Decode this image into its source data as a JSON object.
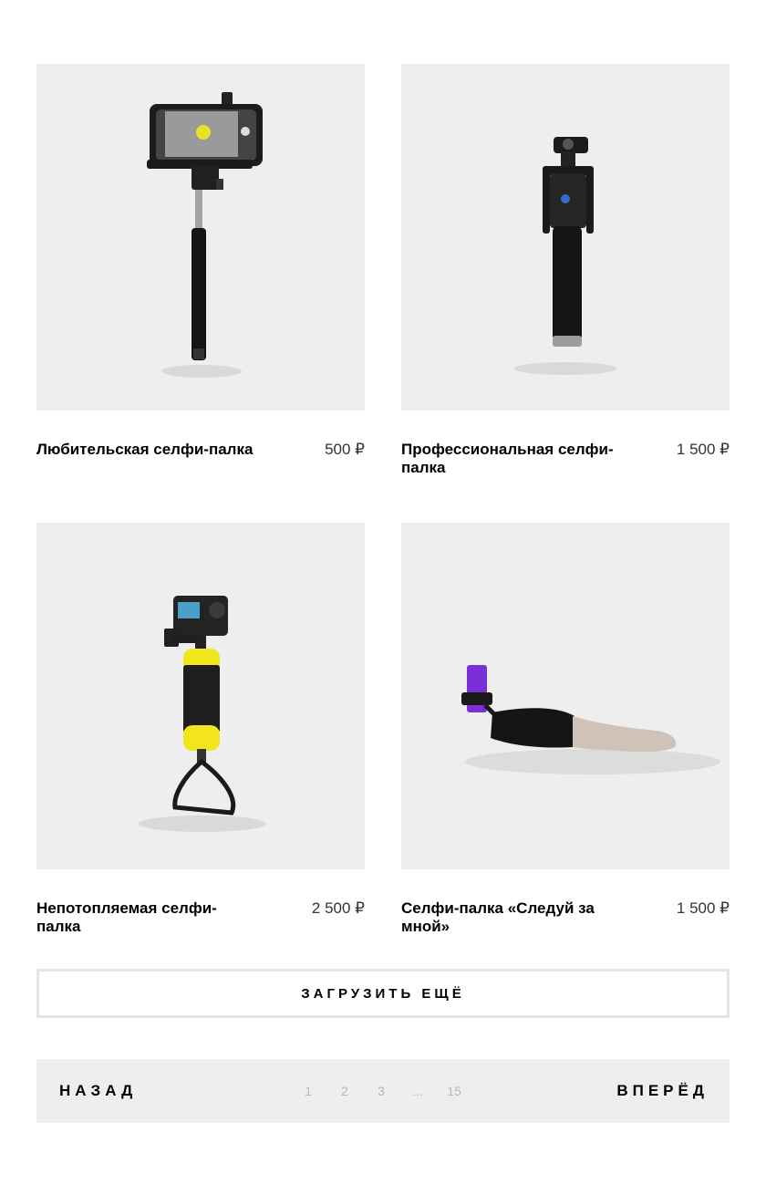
{
  "products": [
    {
      "title": "Любительская селфи-палка",
      "price": "500 ₽"
    },
    {
      "title": "Профессиональная селфи-палка",
      "price": "1 500 ₽"
    },
    {
      "title": "Непотопляемая селфи-палка",
      "price": "2 500 ₽"
    },
    {
      "title": "Селфи-палка «Следуй за мной»",
      "price": "1 500 ₽"
    }
  ],
  "load_more_label": "ЗАГРУЗИТЬ ЕЩЁ",
  "pagination": {
    "prev_label": "НАЗАД",
    "next_label": "ВПЕРЁД",
    "pages": [
      "1",
      "2",
      "3",
      "...",
      "15"
    ]
  },
  "colors": {
    "card_bg": "#eeeeee",
    "pager_bg": "#eeeeee",
    "float_yellow": "#f2e51c",
    "phone_purple": "#7b2fd6",
    "page_num_grey": "#b8b8b8"
  }
}
